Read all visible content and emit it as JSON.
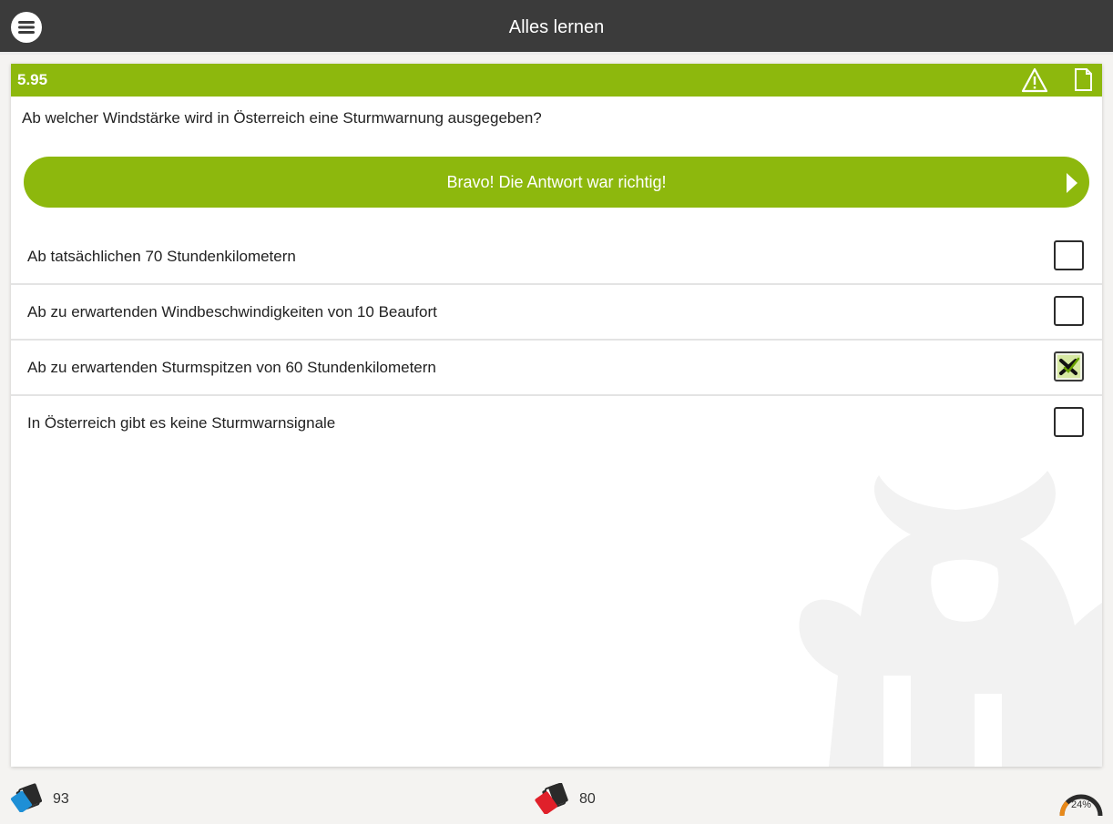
{
  "header": {
    "title": "Alles lernen",
    "menu_icon": "hamburger-menu-icon"
  },
  "question": {
    "number": "5.95",
    "text": "Ab welcher Windstärke wird in Österreich eine Sturmwarnung ausgegeben?",
    "header_icons": [
      "warning-icon",
      "note-icon"
    ],
    "feedback": "Bravo! Die Antwort war richtig!"
  },
  "answers": [
    {
      "text": "Ab tatsächlichen 70 Stundenkilometern",
      "checked": false
    },
    {
      "text": "Ab zu erwartenden Windbeschwindigkeiten von 10 Beaufort",
      "checked": false
    },
    {
      "text": "Ab zu erwartenden Sturmspitzen von 60 Stundenkilometern",
      "checked": true
    },
    {
      "text": "In Österreich gibt es keine Sturmwarnsignale",
      "checked": false
    }
  ],
  "footer": {
    "left_count": "93",
    "middle_count": "80",
    "progress_label": "24%",
    "progress_fraction": 0.24
  },
  "colors": {
    "accent_green": "#8db80d",
    "topbar": "#3b3b3b",
    "left_cards": "#1e8fd6",
    "middle_cards": "#e0202a",
    "gauge_fill": "#e8891a"
  }
}
